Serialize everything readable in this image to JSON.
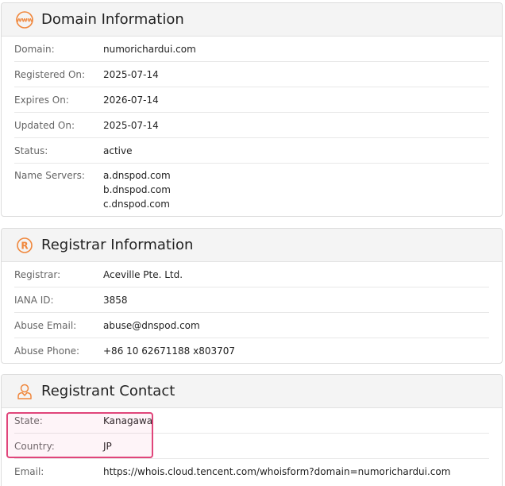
{
  "colors": {
    "accent": "#f0873c",
    "highlight": "#e0457a"
  },
  "domain_info": {
    "title": "Domain Information",
    "icon": "www-globe-icon",
    "rows": [
      {
        "label": "Domain:",
        "value": "numorichardui.com"
      },
      {
        "label": "Registered On:",
        "value": "2025-07-14"
      },
      {
        "label": "Expires On:",
        "value": "2026-07-14"
      },
      {
        "label": "Updated On:",
        "value": "2025-07-14"
      },
      {
        "label": "Status:",
        "value": "active"
      }
    ],
    "name_servers": {
      "label": "Name Servers:",
      "values": [
        "a.dnspod.com",
        "b.dnspod.com",
        "c.dnspod.com"
      ]
    }
  },
  "registrar_info": {
    "title": "Registrar Information",
    "icon": "registered-icon",
    "rows": [
      {
        "label": "Registrar:",
        "value": "Aceville Pte. Ltd."
      },
      {
        "label": "IANA ID:",
        "value": "3858"
      },
      {
        "label": "Abuse Email:",
        "value": "abuse@dnspod.com"
      },
      {
        "label": "Abuse Phone:",
        "value": "+86 10 62671188 x803707"
      }
    ]
  },
  "registrant_contact": {
    "title": "Registrant Contact",
    "icon": "person-icon",
    "rows": [
      {
        "label": "State:",
        "value": "Kanagawa"
      },
      {
        "label": "Country:",
        "value": "JP"
      },
      {
        "label": "Email:",
        "value": "https://whois.cloud.tencent.com/whoisform?domain=numorichardui.com"
      }
    ]
  }
}
